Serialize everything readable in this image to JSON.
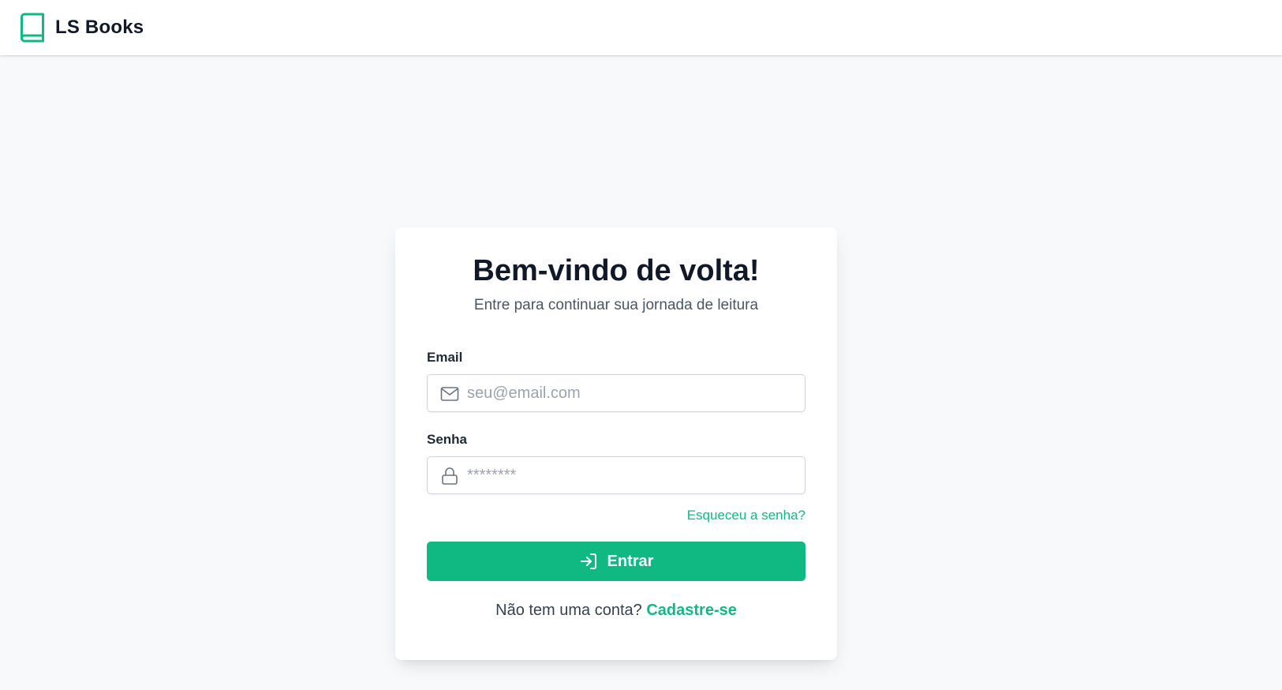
{
  "header": {
    "brand_name": "LS Books",
    "brand_icon": "book-icon"
  },
  "login": {
    "title": "Bem-vindo de volta!",
    "subtitle": "Entre para continuar sua jornada de leitura",
    "email": {
      "label": "Email",
      "placeholder": "seu@email.com",
      "value": "",
      "icon": "mail-icon"
    },
    "password": {
      "label": "Senha",
      "placeholder": "********",
      "value": "",
      "icon": "lock-icon"
    },
    "forgot_password": "Esqueceu a senha?",
    "submit": {
      "label": "Entrar",
      "icon": "login-icon"
    },
    "signup": {
      "prompt": "Não tem uma conta?",
      "link": "Cadastre-se"
    }
  },
  "colors": {
    "accent": "#10b981",
    "background": "#f8f9fb",
    "text_primary": "#111827",
    "text_muted": "#4b5563"
  }
}
